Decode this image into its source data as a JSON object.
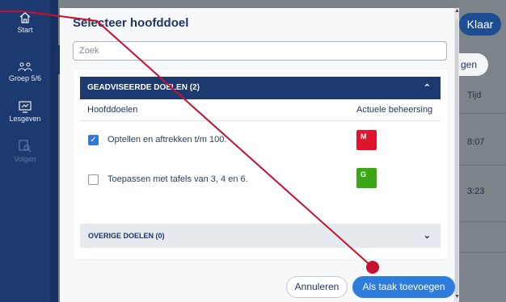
{
  "sidebar": {
    "items": [
      {
        "label": "Start",
        "icon": "home-icon"
      },
      {
        "label": "Groep 5/6",
        "icon": "group-icon"
      },
      {
        "label": "Lesgeven",
        "icon": "teach-screen-icon"
      },
      {
        "label": "Volgen",
        "icon": "follow-search-icon"
      }
    ]
  },
  "background": {
    "klaar_label": "Klaar",
    "partial_button_label": "gen",
    "column_header": "Tijd",
    "values": [
      "8:07",
      "3:23"
    ]
  },
  "modal": {
    "title": "Selecteer hoofddoel",
    "search_placeholder": "Zoek",
    "advised_section": {
      "title": "GEADVISEERDE DOELEN (2)",
      "col_goals": "Hoofddoelen",
      "col_mastery": "Actuele beheersing",
      "rows": [
        {
          "label": "Optellen en aftrekken t/m 100.",
          "checked": true,
          "mastery": "M",
          "mastery_color": "#e0152b"
        },
        {
          "label": "Toepassen met tafels van 3, 4 en 6.",
          "checked": false,
          "mastery": "G",
          "mastery_color": "#3aa714"
        }
      ]
    },
    "other_section": {
      "title": "OVERIGE DOELEN (0)"
    },
    "cancel_label": "Annuleren",
    "primary_label": "Als taak toevoegen"
  },
  "colors": {
    "sidebar": "#1c3a6f",
    "primary": "#2e7cdc",
    "annotation": "#c8102e"
  }
}
